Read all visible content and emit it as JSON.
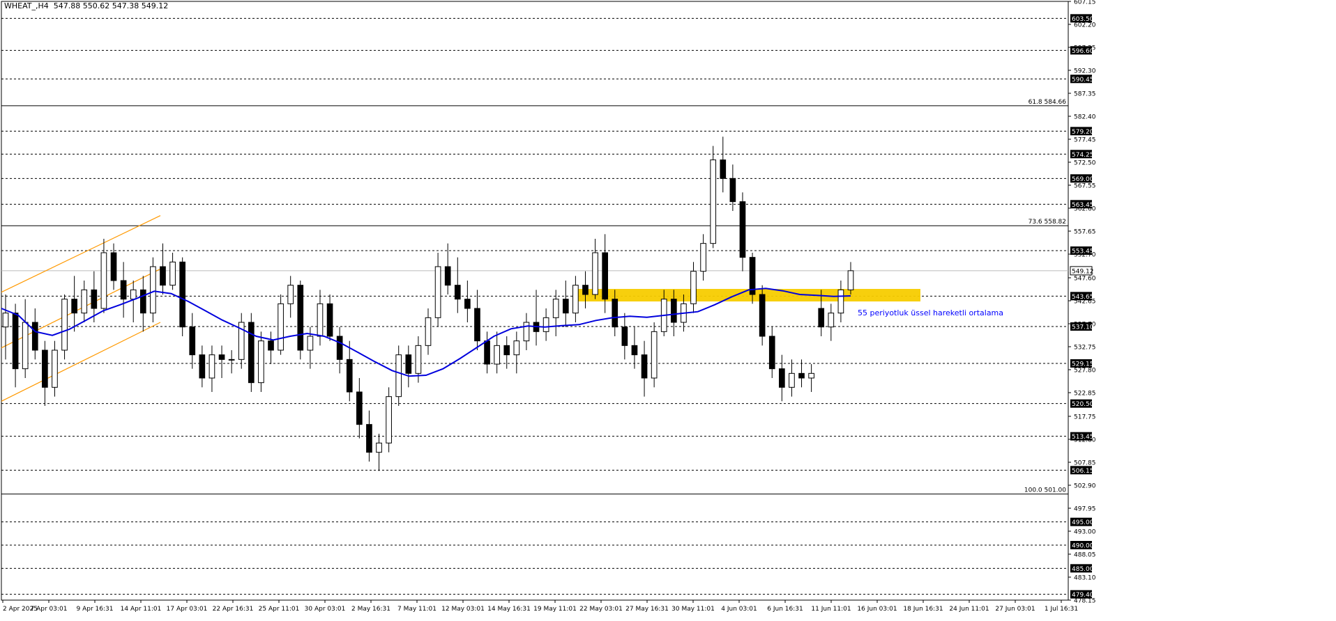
{
  "header": {
    "symbol": "WHEAT_,H4",
    "ohlc": "547.88 550.62 547.38 549.12"
  },
  "colors": {
    "background": "#ffffff",
    "candle": "#000000",
    "grid_dashed": "#000000",
    "ema": "#0000dd",
    "channel": "#ff9900",
    "zone": "#f7cc00",
    "label_bg": "#000000",
    "label_text": "#ffffff",
    "annotation": "#0000ff"
  },
  "annotation": {
    "ema_label": "55 periyotluk üssel hareketli ortalama"
  },
  "chart_data": {
    "type": "candlestick",
    "title": "WHEAT_,H4",
    "ylim": [
      478.15,
      607.15
    ],
    "y_ticks": [
      "607.15",
      "602.20",
      "597.25",
      "592.30",
      "587.35",
      "582.40",
      "577.45",
      "572.50",
      "567.55",
      "562.60",
      "557.65",
      "552.70",
      "547.60",
      "542.65",
      "537.70",
      "532.75",
      "527.80",
      "522.85",
      "517.75",
      "512.80",
      "507.85",
      "502.90",
      "497.95",
      "493.00",
      "488.05",
      "483.10",
      "478.15"
    ],
    "x_ticks": [
      "2 Apr 2025",
      "7 Apr 03:01",
      "9 Apr 16:31",
      "14 Apr 11:01",
      "17 Apr 03:01",
      "22 Apr 16:31",
      "25 Apr 11:01",
      "30 Apr 03:01",
      "2 May 16:31",
      "7 May 11:01",
      "12 May 03:01",
      "14 May 16:31",
      "19 May 11:01",
      "22 May 03:01",
      "27 May 16:31",
      "30 May 11:01",
      "4 Jun 03:01",
      "6 Jun 16:31",
      "11 Jun 11:01",
      "16 Jun 03:01",
      "18 Jun 16:31",
      "24 Jun 11:01",
      "27 Jun 03:01",
      "1 Jul 16:31"
    ],
    "current_price": {
      "value": 549.12,
      "label": "549.12"
    },
    "horizontal_levels": [
      {
        "value": 603.5,
        "label": "603.50"
      },
      {
        "value": 596.6,
        "label": "596.60"
      },
      {
        "value": 590.45,
        "label": "590.45"
      },
      {
        "value": 579.2,
        "label": "579.20"
      },
      {
        "value": 574.25,
        "label": "574.25"
      },
      {
        "value": 569.0,
        "label": "569.00"
      },
      {
        "value": 563.45,
        "label": "563.45"
      },
      {
        "value": 553.45,
        "label": "553.45"
      },
      {
        "value": 543.65,
        "label": "543.65"
      },
      {
        "value": 537.1,
        "label": "537.10"
      },
      {
        "value": 529.15,
        "label": "529.15"
      },
      {
        "value": 520.5,
        "label": "520.50"
      },
      {
        "value": 513.45,
        "label": "513.45"
      },
      {
        "value": 506.15,
        "label": "506.15"
      },
      {
        "value": 495.0,
        "label": "495.00"
      },
      {
        "value": 490.0,
        "label": "490.00"
      },
      {
        "value": 485.0,
        "label": "485.00"
      },
      {
        "value": 479.4,
        "label": "479.40"
      }
    ],
    "fibonacci_levels": [
      {
        "value": 584.66,
        "label": "61.8 584.66"
      },
      {
        "value": 558.82,
        "label": "73.6 558.82"
      },
      {
        "value": 501.0,
        "label": "100.0 501.00"
      }
    ],
    "support_zone": {
      "from": 542.5,
      "to": 545.2
    },
    "channel": {
      "x_from": "2 Apr 2025",
      "x_to": "17 Apr 03:01",
      "upper": [
        544.5,
        561.0
      ],
      "middle": [
        532.5,
        549.5
      ],
      "lower": [
        521.0,
        538.0
      ]
    },
    "candles": [
      [
        "2 Apr 2025",
        537,
        544,
        530,
        540
      ],
      [
        "2 Apr 2025",
        540,
        542,
        524,
        528
      ],
      [
        "4 Apr",
        528,
        543,
        526,
        538
      ],
      [
        "4 Apr",
        538,
        541,
        530,
        532
      ],
      [
        "7 Apr 03:01",
        532,
        534,
        520,
        524
      ],
      [
        "7 Apr 03:01",
        524,
        534,
        522,
        532
      ],
      [
        "8 Apr",
        532,
        544,
        530,
        543
      ],
      [
        "9 Apr 16:31",
        543,
        548,
        536,
        540
      ],
      [
        "9 Apr 16:31",
        540,
        547,
        538,
        545
      ],
      [
        "10 Apr",
        545,
        549,
        538,
        541
      ],
      [
        "10 Apr",
        541,
        556,
        540,
        553
      ],
      [
        "11 Apr",
        553,
        555,
        545,
        547
      ],
      [
        "14 Apr 11:01",
        547,
        551,
        539,
        543
      ],
      [
        "14 Apr 11:01",
        543,
        547,
        538,
        545
      ],
      [
        "15 Apr",
        545,
        548,
        536,
        540
      ],
      [
        "16 Apr",
        540,
        552,
        538,
        550
      ],
      [
        "17 Apr 03:01",
        550,
        555,
        544,
        546
      ],
      [
        "17 Apr 03:01",
        546,
        553,
        545,
        551
      ],
      [
        "18 Apr",
        551,
        552,
        535,
        537
      ],
      [
        "22 Apr 16:31",
        537,
        540,
        528,
        531
      ],
      [
        "22 Apr 16:31",
        531,
        533,
        524,
        526
      ],
      [
        "23 Apr",
        526,
        533,
        523,
        531
      ],
      [
        "24 Apr",
        531,
        533,
        526,
        530
      ],
      [
        "25 Apr 11:01",
        530,
        532,
        527,
        530
      ],
      [
        "28 Apr",
        530,
        540,
        528,
        538
      ],
      [
        "29 Apr",
        538,
        540,
        523,
        525
      ],
      [
        "30 Apr 03:01",
        525,
        536,
        523,
        534
      ],
      [
        "30 Apr 03:01",
        534,
        536,
        529,
        532
      ],
      [
        "1 May",
        532,
        544,
        531,
        542
      ],
      [
        "2 May 16:31",
        542,
        548,
        539,
        546
      ],
      [
        "2 May 16:31",
        546,
        547,
        530,
        532
      ],
      [
        "5 May",
        532,
        537,
        528,
        535
      ],
      [
        "6 May",
        535,
        545,
        533,
        542
      ],
      [
        "7 May 11:01",
        542,
        544,
        534,
        535
      ],
      [
        "7 May 11:01",
        535,
        537,
        527,
        530
      ],
      [
        "8 May",
        530,
        534,
        521,
        523
      ],
      [
        "9 May",
        523,
        526,
        513,
        516
      ],
      [
        "12 May 03:01",
        516,
        519,
        508,
        510
      ],
      [
        "12 May 03:01",
        510,
        514,
        506,
        512
      ],
      [
        "13 May",
        512,
        524,
        510,
        522
      ],
      [
        "14 May 16:31",
        522,
        533,
        520,
        531
      ],
      [
        "14 May 16:31",
        531,
        533,
        524,
        527
      ],
      [
        "15 May",
        527,
        535,
        525,
        533
      ],
      [
        "16 May",
        533,
        541,
        531,
        539
      ],
      [
        "19 May 11:01",
        539,
        553,
        537,
        550
      ],
      [
        "19 May 11:01",
        550,
        555,
        544,
        546
      ],
      [
        "20 May",
        546,
        552,
        540,
        543
      ],
      [
        "21 May",
        543,
        547,
        538,
        541
      ],
      [
        "22 May 03:01",
        541,
        545,
        532,
        534
      ],
      [
        "22 May 03:01",
        534,
        536,
        527,
        529
      ],
      [
        "23 May",
        529,
        536,
        527,
        533
      ],
      [
        "26 May",
        533,
        535,
        528,
        531
      ],
      [
        "27 May 16:31",
        531,
        536,
        527,
        534
      ],
      [
        "28 May",
        534,
        540,
        532,
        538
      ],
      [
        "29 May",
        538,
        545,
        533,
        536
      ],
      [
        "30 May 11:01",
        536,
        541,
        534,
        539
      ],
      [
        "2 Jun",
        539,
        545,
        535,
        543
      ],
      [
        "3 Jun",
        543,
        547,
        537,
        540
      ],
      [
        "4 Jun 03:01",
        540,
        548,
        538,
        546
      ],
      [
        "4 Jun 03:01",
        546,
        549,
        541,
        544
      ],
      [
        "5 Jun",
        544,
        556,
        543,
        553
      ],
      [
        "6 Jun 16:31",
        553,
        557,
        540,
        543
      ],
      [
        "6 Jun 16:31",
        543,
        545,
        535,
        537
      ],
      [
        "9 Jun",
        537,
        540,
        530,
        533
      ],
      [
        "10 Jun",
        533,
        537,
        528,
        531
      ],
      [
        "11 Jun 11:01",
        531,
        534,
        522,
        526
      ],
      [
        "11 Jun 11:01",
        526,
        538,
        524,
        536
      ],
      [
        "12 Jun",
        536,
        545,
        535,
        543
      ],
      [
        "13 Jun",
        543,
        545,
        535,
        538
      ],
      [
        "16 Jun 03:01",
        538,
        544,
        536,
        542
      ],
      [
        "16 Jun 03:01",
        542,
        551,
        540,
        549
      ],
      [
        "17 Jun",
        549,
        557,
        547,
        555
      ],
      [
        "18 Jun 16:31",
        555,
        576,
        554,
        573
      ],
      [
        "18 Jun 16:31",
        573,
        578,
        566,
        569
      ],
      [
        "19 Jun",
        569,
        572,
        562,
        564
      ],
      [
        "20 Jun",
        564,
        566,
        549,
        552
      ],
      [
        "23 Jun",
        552,
        553,
        542,
        544
      ],
      [
        "24 Jun 11:01",
        544,
        546,
        533,
        535
      ],
      [
        "24 Jun 11:01",
        535,
        537,
        526,
        528
      ],
      [
        "25 Jun",
        528,
        531,
        521,
        524
      ],
      [
        "26 Jun",
        524,
        530,
        522,
        527
      ],
      [
        "27 Jun 03:01",
        527,
        530,
        524,
        526
      ],
      [
        "27 Jun 03:01",
        526,
        529,
        523,
        527
      ],
      [
        "30 Jun",
        541,
        545,
        535,
        537
      ],
      [
        "30 Jun",
        537,
        542,
        534,
        540
      ],
      [
        "1 Jul 16:31",
        540,
        547,
        538,
        545
      ],
      [
        "1 Jul 16:31",
        545,
        551,
        544,
        549.12
      ]
    ],
    "ema_55": [
      541.0,
      539.5,
      536.0,
      535.2,
      536.5,
      538.5,
      540.5,
      541.8,
      543.2,
      544.7,
      544.2,
      542.5,
      540.5,
      538.5,
      536.8,
      535.0,
      534.2,
      535.0,
      535.6,
      535.0,
      533.5,
      531.5,
      529.5,
      527.6,
      526.4,
      526.6,
      528.0,
      530.2,
      532.6,
      535.0,
      536.6,
      537.2,
      537.0,
      537.3,
      537.5,
      538.4,
      539.0,
      539.3,
      539.1,
      539.5,
      539.9,
      540.3,
      541.8,
      543.5,
      545.0,
      545.3,
      544.8,
      544.0,
      543.8,
      543.6,
      543.7
    ]
  }
}
